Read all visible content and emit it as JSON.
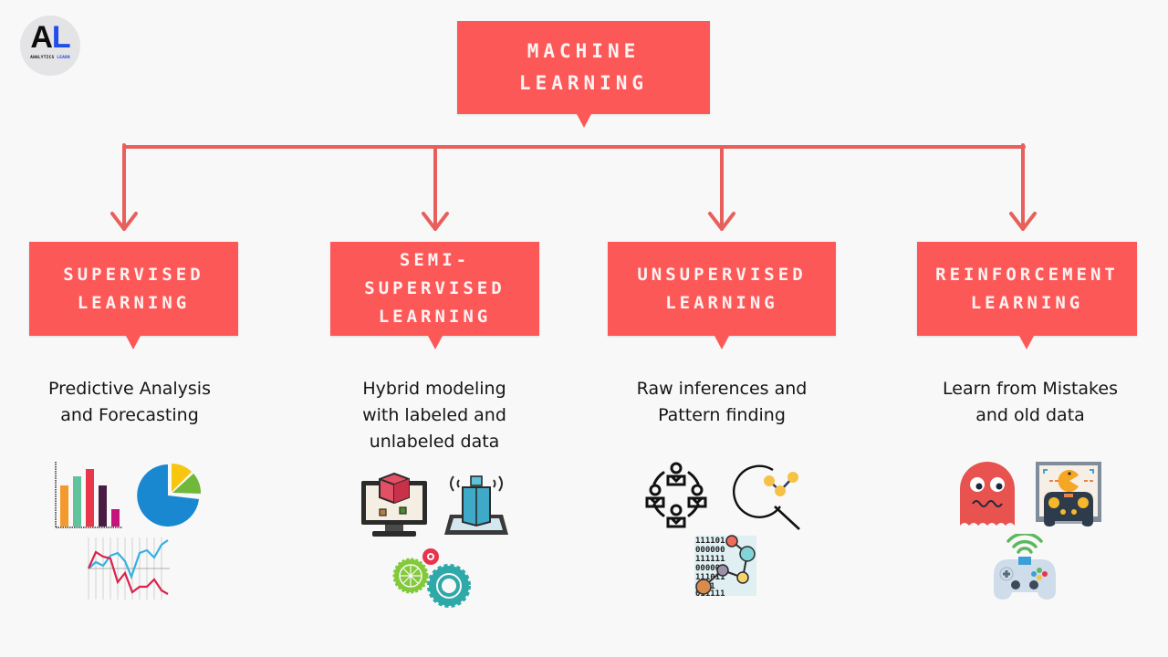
{
  "logo": {
    "letters_primary": "A",
    "letters_accent": "L",
    "subtitle_primary": "ANALYTICS",
    "subtitle_accent": "LEARN",
    "colors": {
      "primary": "#0d0d0d",
      "accent": "#1f4fe8",
      "background": "#e4e4e6"
    }
  },
  "root": {
    "title": "MACHINE\nLEARNING"
  },
  "theme": {
    "box_color": "#fd5858",
    "connector_color": "#e8605c",
    "text_color": "#151515",
    "background": "#f8f8f9"
  },
  "categories": [
    {
      "title": "SUPERVISED\nLEARNING",
      "description": "Predictive Analysis\nand Forecasting",
      "icons": [
        "bar-chart-icon",
        "pie-chart-icon",
        "line-chart-icon"
      ]
    },
    {
      "title": "SEMI-\nSUPERVISED\nLEARNING",
      "description": "Hybrid modeling\nwith labeled and\nunlabeled data",
      "icons": [
        "monitor-3d-cube-icon",
        "hologram-building-icon",
        "gears-icon"
      ]
    },
    {
      "title": "UNSUPERVISED\nLEARNING",
      "description": "Raw inferences and\nPattern finding",
      "icons": [
        "people-network-icon",
        "magnify-graph-icon",
        "binary-data-cluster-icon"
      ]
    },
    {
      "title": "REINFORCEMENT\nLEARNING",
      "description": "Learn from Mistakes\nand old data",
      "icons": [
        "ghost-icon",
        "arcade-screen-controller-icon",
        "wireless-gamepad-icon"
      ]
    }
  ]
}
